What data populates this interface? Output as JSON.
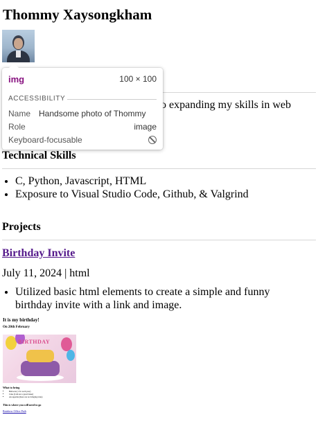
{
  "header": {
    "name": "Thommy Xaysongkham"
  },
  "profile_image": {
    "alt": "Handsome photo of Thommy"
  },
  "about": {
    "text_visible": "o expanding my skills in web"
  },
  "skills": {
    "heading": "Technical Skills",
    "items": [
      "C, Python, Javascript, HTML",
      "Exposure to Visual Studio Code, Github, & Valgrind"
    ]
  },
  "projects": {
    "heading": "Projects",
    "items": [
      {
        "title": "Birthday Invite",
        "date": "July 11, 2024",
        "separator": "|",
        "tech": "html",
        "bullets": [
          "Utilized basic html elements to create a simple and funny birthday invite with a link and image."
        ],
        "preview": {
          "title": "It is my birthday!",
          "subtitle": "On 20th February",
          "cake_banner": "BIRTHDAY",
          "bring_heading": "What to bring",
          "bring_items": [
            "Balloons (1 for each year)",
            "Cake (I am not a great baker)",
            "An appetite (there are no bringing rules)"
          ],
          "where_heading": "This is where you will need to go",
          "link_text": "Rainbow Office Path"
        }
      }
    ]
  },
  "devtools_tooltip": {
    "tag": "img",
    "dimensions": "100 × 100",
    "accessibility_heading": "ACCESSIBILITY",
    "name_label": "Name",
    "name_value": "Handsome photo of Thommy",
    "role_label": "Role",
    "role_value": "image",
    "focusable_label": "Keyboard-focusable"
  },
  "colors": {
    "link_visited": "#551a8b",
    "tooltip_tag": "#881280",
    "divider": "#d6d6d6"
  }
}
